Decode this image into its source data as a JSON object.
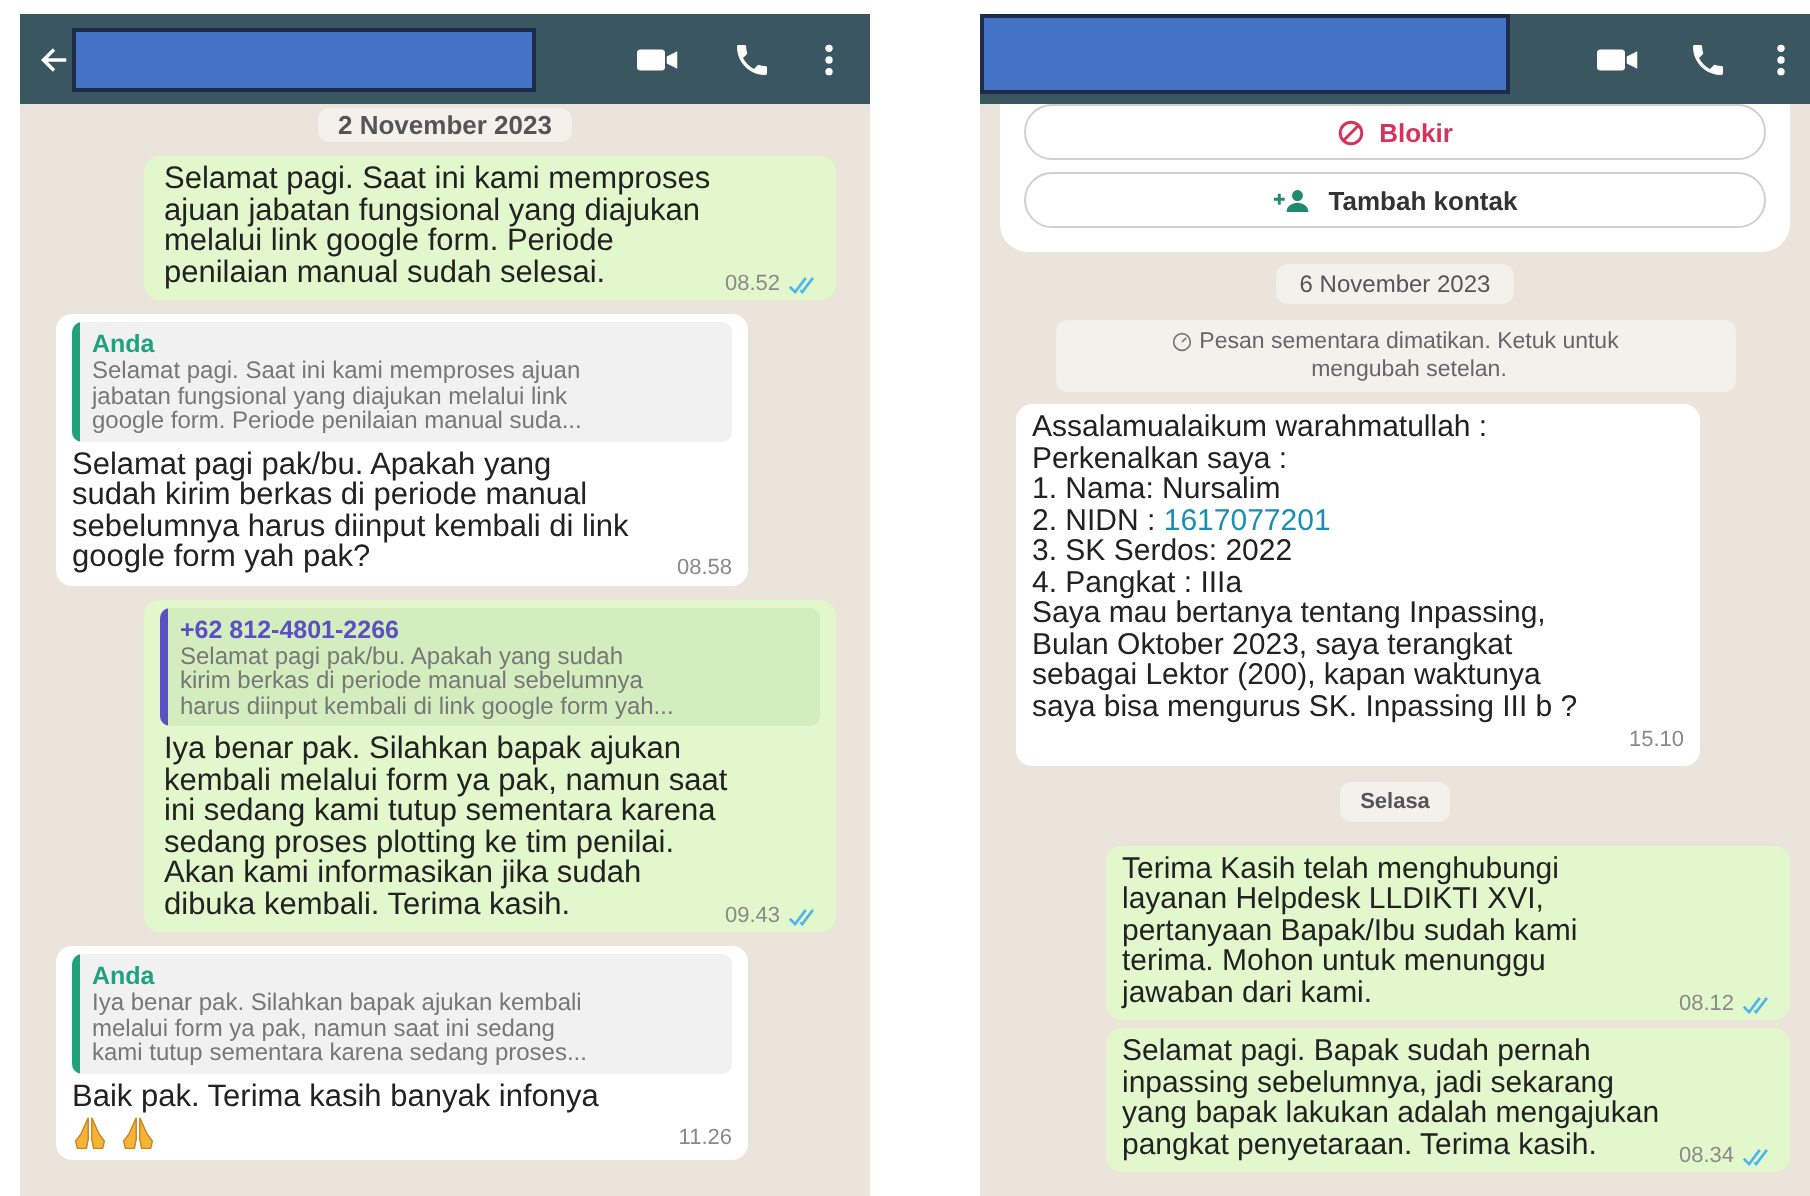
{
  "left_chat": {
    "date_chip": "2 November 2023",
    "messages": [
      {
        "kind": "outgoing",
        "text": "Selamat pagi. Saat ini kami memproses\najuan jabatan fungsional yang diajukan\nmelalui link google form. Periode\npenilaian manual sudah selesai.",
        "time": "08.52",
        "read": true
      },
      {
        "kind": "incoming",
        "quote": {
          "author": "Anda",
          "color": "#1fa27a",
          "text": "Selamat pagi. Saat ini kami memproses ajuan\njabatan fungsional yang diajukan melalui link\ngoogle form. Periode penilaian manual suda..."
        },
        "text": "Selamat pagi pak/bu. Apakah yang\nsudah kirim berkas di periode manual\nsebelumnya harus diinput kembali di link\ngoogle form yah pak?",
        "time": "08.58"
      },
      {
        "kind": "outgoing",
        "quote": {
          "author": "+62 812-4801-2266",
          "color": "#5b4fc4",
          "text": "Selamat pagi pak/bu. Apakah yang sudah\nkirim berkas di periode manual sebelumnya\nharus diinput kembali di link google form yah..."
        },
        "text": "Iya benar pak. Silahkan bapak ajukan\nkembali melalui form ya pak, namun saat\nini sedang kami tutup sementara karena\nsedang proses plotting ke tim penilai.\nAkan kami informasikan jika sudah\ndibuka kembali. Terima kasih.",
        "time": "09.43",
        "read": true
      },
      {
        "kind": "incoming",
        "quote": {
          "author": "Anda",
          "color": "#1fa27a",
          "text": "Iya benar pak. Silahkan bapak ajukan kembali\nmelalui form ya pak, namun saat ini sedang\nkami tutup sementara karena sedang proses..."
        },
        "text": "Baik pak. Terima kasih banyak infonya",
        "emoji": [
          {
            "kind": "praying_hands"
          },
          {
            "kind": "praying_hands"
          }
        ],
        "time": "11.26"
      }
    ]
  },
  "right_chat": {
    "contact_actions": [
      {
        "kind": "block",
        "label": "Blokir"
      },
      {
        "kind": "add",
        "label": "Tambah kontak"
      }
    ],
    "date_chip": "6 November 2023",
    "system_notice": "Pesan sementara dimatikan. Ketuk untuk\nmengubah setelan.",
    "messages": [
      {
        "kind": "incoming",
        "segments": [
          {
            "kind": "text",
            "text": "Assalamualaikum warahmatullah :\nPerkenalkan saya :\n1.  Nama:  Nursalim\n2.  NIDN : "
          },
          {
            "kind": "link",
            "text": "1617077201"
          },
          {
            "kind": "text",
            "text": "\n3.  SK Serdos:  2022\n4.  Pangkat :  IIIa\nSaya mau bertanya tentang Inpassing,\nBulan Oktober 2023, saya terangkat\nsebagai Lektor (200),  kapan waktunya\nsaya bisa mengurus SK. Inpassing III b ?"
          }
        ],
        "time": "15.10"
      },
      {
        "kind": "day_chip",
        "text": "Selasa"
      },
      {
        "kind": "outgoing",
        "segments": [
          {
            "kind": "text",
            "text": "Terima Kasih telah menghubungi\nlayanan Helpdesk LLDIKTI XVI,\npertanyaan Bapak/Ibu sudah kami\nterima. Mohon untuk menunggu\njawaban dari kami."
          }
        ],
        "time": "08.12",
        "read": true
      },
      {
        "kind": "outgoing",
        "segments": [
          {
            "kind": "text",
            "text": "Selamat pagi. Bapak sudah pernah\ninpassing sebelumnya, jadi sekarang\nyang bapak lakukan adalah mengajukan\npangkat penyetaraan. Terima kasih."
          }
        ],
        "time": "08.34",
        "read": true
      }
    ]
  }
}
